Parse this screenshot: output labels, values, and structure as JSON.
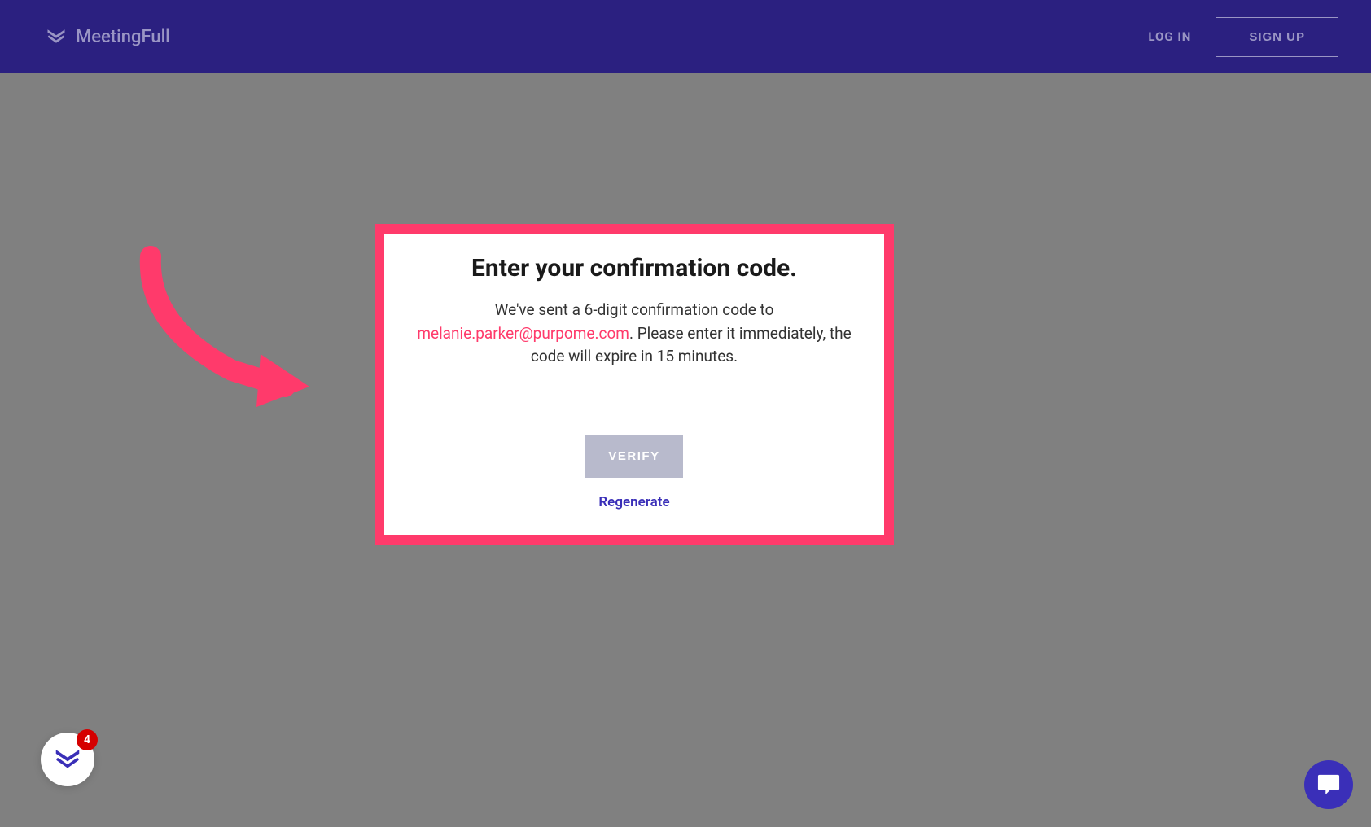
{
  "header": {
    "brand_name": "MeetingFull",
    "login_label": "LOG IN",
    "signup_label": "SIGN UP"
  },
  "modal": {
    "title": "Enter your confirmation code.",
    "description_prefix": "We've sent a 6-digit confirmation code to ",
    "email": "melanie.parker@purpome.com",
    "description_suffix": ". Please enter it immediately, the code will expire in 15 minutes.",
    "verify_label": "VERIFY",
    "regenerate_label": "Regenerate"
  },
  "chat_widget": {
    "badge_count": "4"
  },
  "colors": {
    "primary": "#2b2080",
    "accent": "#ff3a6b",
    "link": "#3a2fb8",
    "muted": "#9a95c4"
  }
}
